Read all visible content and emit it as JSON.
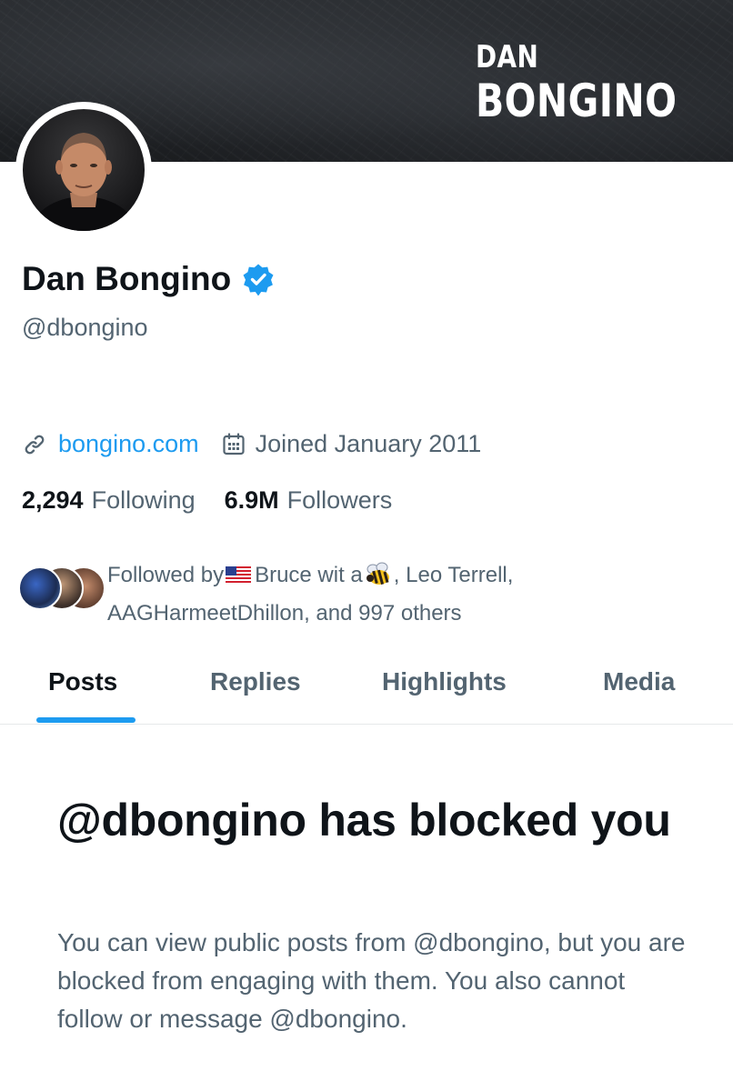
{
  "banner": {
    "line1": "DAN",
    "line2": "BONGINO"
  },
  "profile": {
    "display_name": "Dan Bongino",
    "handle": "@dbongino",
    "website": "bongino.com",
    "joined": "Joined January 2011",
    "verified": true
  },
  "stats": {
    "following_count": "2,294",
    "following_label": "Following",
    "followers_count": "6.9M",
    "followers_label": "Followers"
  },
  "followed_by": {
    "prefix": "Followed by",
    "name1": "Bruce wit a",
    "rest_line1": ", Leo Terrell,",
    "line2": "AAGHarmeetDhillon, and 997 others"
  },
  "tabs": [
    {
      "label": "Posts",
      "active": true
    },
    {
      "label": "Replies",
      "active": false
    },
    {
      "label": "Highlights",
      "active": false
    },
    {
      "label": "Media",
      "active": false
    }
  ],
  "blocked": {
    "title": "@dbongino has blocked you",
    "body": "You can view public posts from @dbongino, but you are blocked from engaging with them. You also cannot follow or message @dbongino."
  },
  "icons": {
    "verified": "verified-badge-icon",
    "link": "link-icon",
    "calendar": "calendar-icon"
  },
  "colors": {
    "accent": "#1d9bf0",
    "text_primary": "#0f1419",
    "text_secondary": "#536471",
    "divider": "#e6e9ea",
    "banner": "#1f2125"
  }
}
